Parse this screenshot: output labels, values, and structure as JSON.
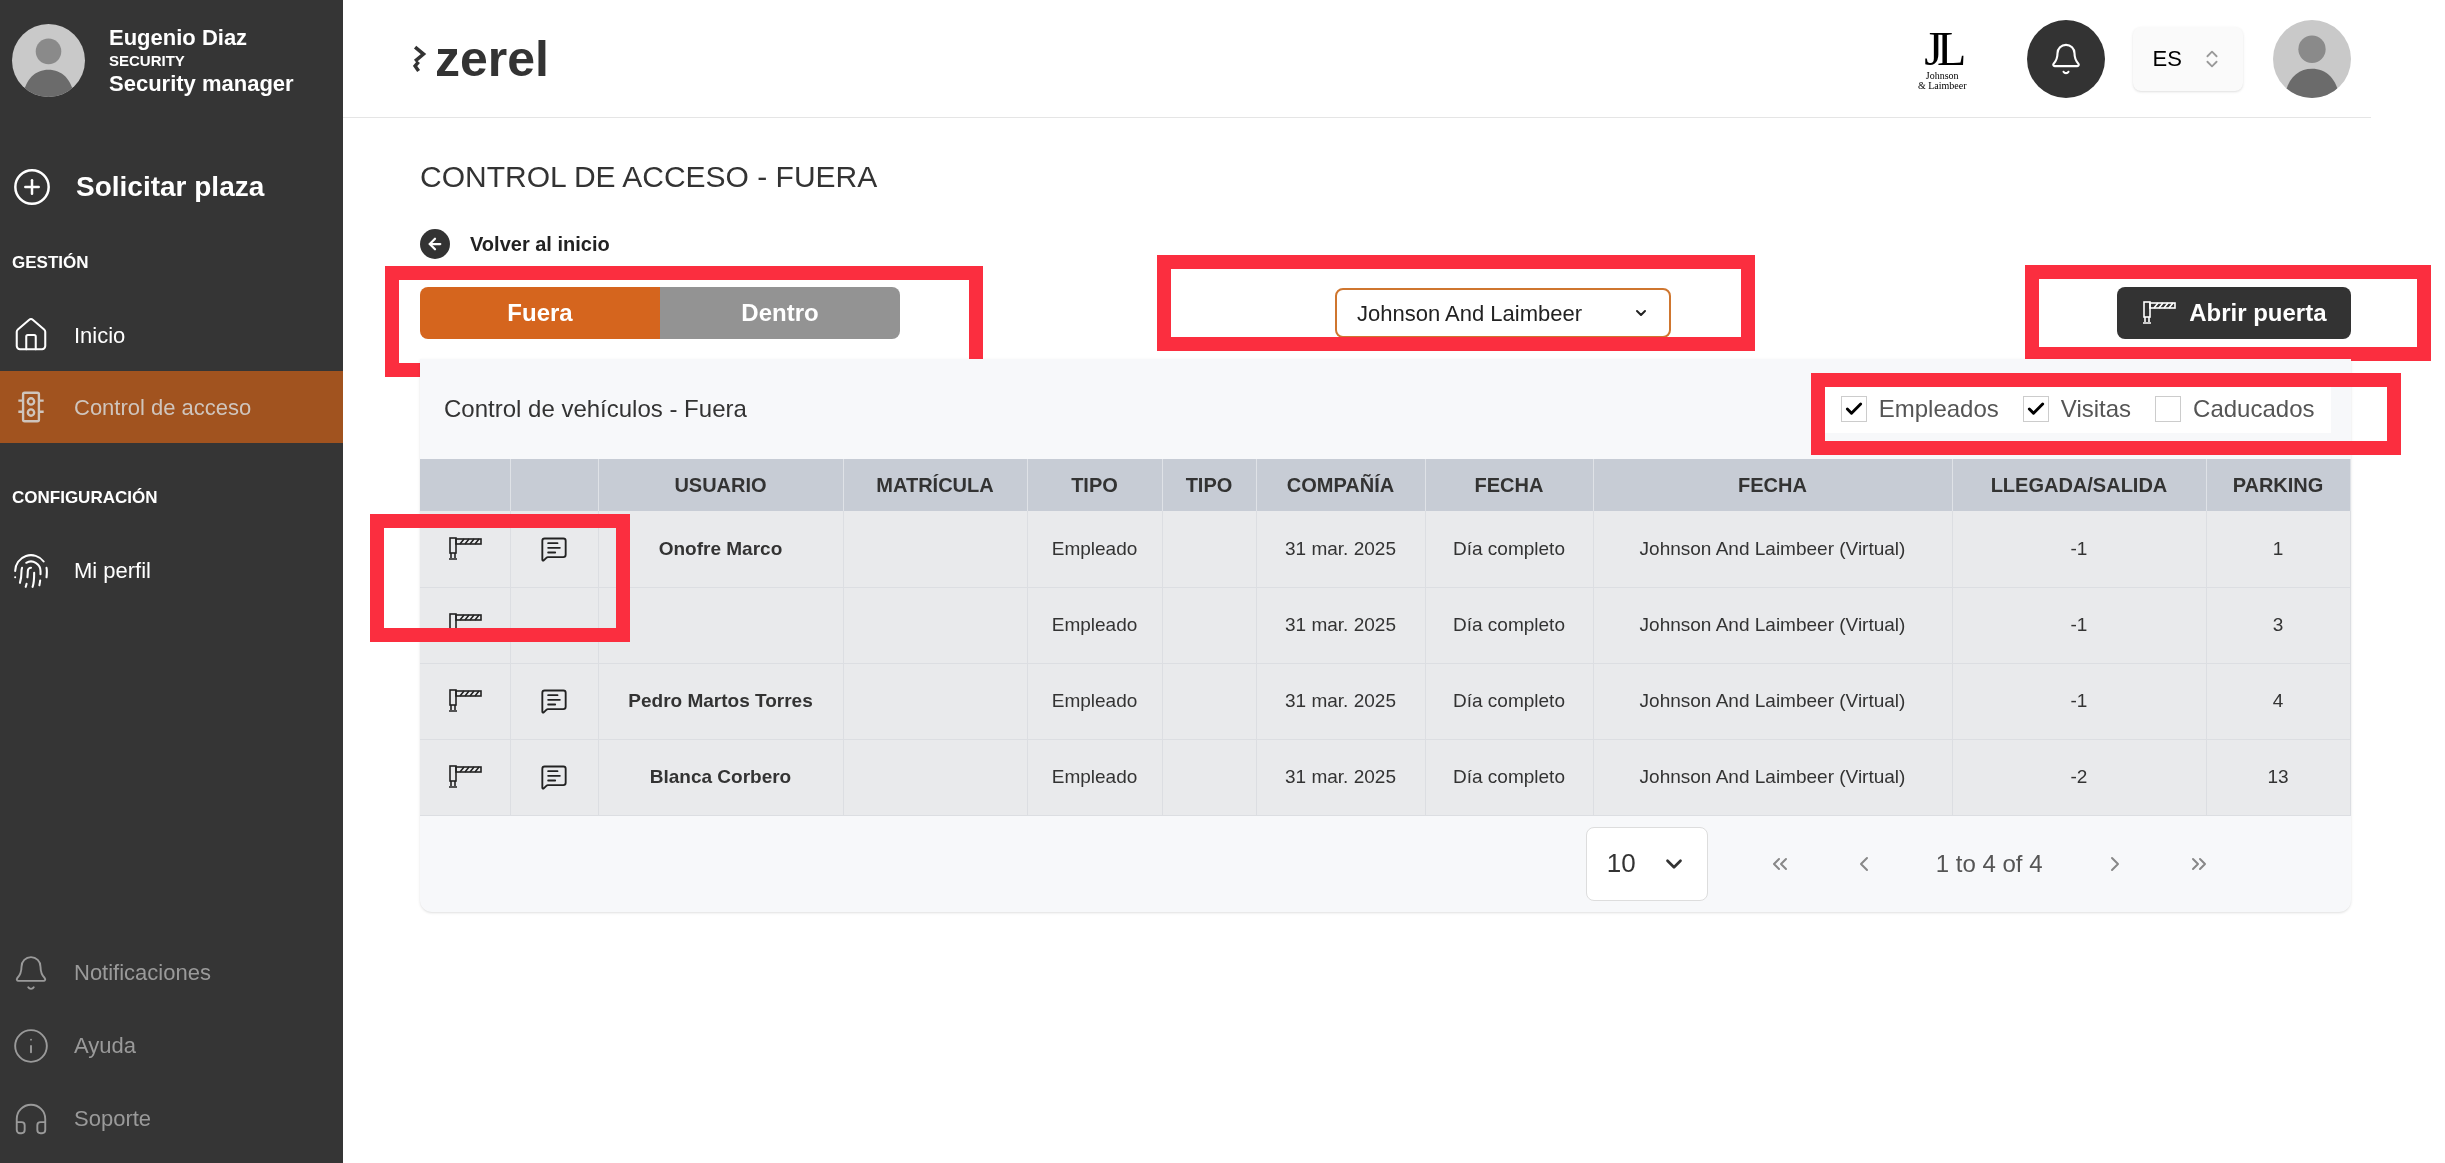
{
  "sidebar": {
    "user": {
      "name": "Eugenio Diaz",
      "department": "SECURITY",
      "role": "Security manager"
    },
    "request_button": "Solicitar plaza",
    "sections": [
      {
        "title": "GESTIÓN",
        "items": [
          {
            "label": "Inicio",
            "kind": "home",
            "selected": false
          },
          {
            "label": "Control de acceso",
            "kind": "traffic",
            "selected": true
          }
        ]
      },
      {
        "title": "CONFIGURACIÓN",
        "items": [
          {
            "label": "Mi perfil",
            "kind": "fingerprint",
            "selected": false
          }
        ]
      }
    ],
    "footer_items": [
      {
        "label": "Notificaciones",
        "kind": "bell"
      },
      {
        "label": "Ayuda",
        "kind": "info"
      },
      {
        "label": "Soporte",
        "kind": "headset"
      }
    ]
  },
  "header": {
    "brand": "zerel",
    "company_logo": {
      "monogram": "JL",
      "line1": "Johnson",
      "line2": "& Laimbeer"
    },
    "language": "ES"
  },
  "page": {
    "title": "CONTROL DE ACCESO - FUERA",
    "back_link": "Volver al inicio",
    "tabs": [
      {
        "label": "Fuera",
        "selected": true
      },
      {
        "label": "Dentro",
        "selected": false
      }
    ],
    "company_select": "Johnson And Laimbeer",
    "open_door_button": "Abrir puerta"
  },
  "card": {
    "title": "Control de vehículos - Fuera",
    "filters": [
      {
        "label": "Empleados",
        "checked": true
      },
      {
        "label": "Visitas",
        "checked": true
      },
      {
        "label": "Caducados",
        "checked": false
      }
    ],
    "table": {
      "columns": [
        "USUARIO",
        "MATRÍCULA",
        "TIPO",
        "TIPO",
        "COMPAÑÍA",
        "FECHA",
        "FECHA",
        "LLEGADA/SALIDA",
        "PARKING"
      ],
      "rows": [
        {
          "comment": true,
          "cells": [
            "Onofre Marco",
            null,
            "Empleado",
            null,
            "31 mar. 2025",
            "Día completo",
            "Johnson And Laimbeer (Virtual)",
            "-1",
            "1"
          ]
        },
        {
          "comment": false,
          "cells": [
            null,
            null,
            "Empleado",
            null,
            "31 mar. 2025",
            "Día completo",
            "Johnson And Laimbeer (Virtual)",
            "-1",
            "3"
          ]
        },
        {
          "comment": true,
          "cells": [
            "Pedro Martos Torres",
            null,
            "Empleado",
            null,
            "31 mar. 2025",
            "Día completo",
            "Johnson And Laimbeer (Virtual)",
            "-1",
            "4"
          ]
        },
        {
          "comment": true,
          "cells": [
            "Blanca Corbero",
            null,
            "Empleado",
            null,
            "31 mar. 2025",
            "Día completo",
            "Johnson And Laimbeer (Virtual)",
            "-2",
            "13"
          ]
        }
      ]
    },
    "pagination": {
      "page_size": "10",
      "range": "1 to 4 of 4"
    }
  },
  "highlights": {
    "tabs": true,
    "company_select": true,
    "open_door": true,
    "filters": true,
    "row_actions": true
  }
}
